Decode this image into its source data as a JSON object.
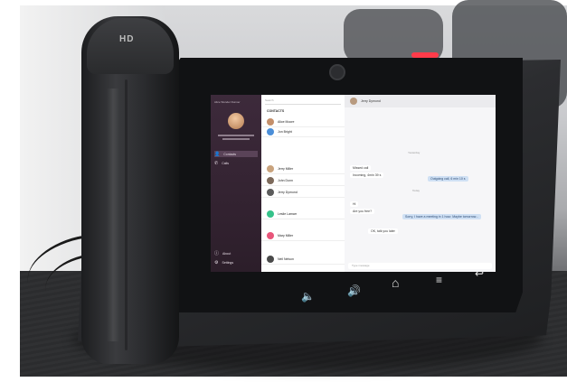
{
  "handset": {
    "brand": "HD"
  },
  "screen": {
    "owner_name": "Alice Wonder Dunner",
    "nav_items": [
      {
        "label": "Contacts",
        "icon": "person-icon",
        "active": true
      },
      {
        "label": "Calls",
        "icon": "phone-icon",
        "active": false
      }
    ],
    "nav_bottom": [
      {
        "label": "About",
        "icon": "info-icon"
      },
      {
        "label": "Settings",
        "icon": "gear-icon"
      }
    ],
    "search_placeholder": "Search",
    "contacts_title": "CONTACTS",
    "contacts": [
      {
        "letter": "",
        "name": "Alice Moore",
        "color": "#c48f6a"
      },
      {
        "letter": "",
        "name": "Jon Bright",
        "color": "#4b8ed8"
      },
      {
        "letter": "",
        "name": "Jerry Miller",
        "color": "#c9a37d"
      },
      {
        "letter": "",
        "name": "John Dunn",
        "color": "#7d6a5b"
      },
      {
        "letter": "",
        "name": "Jerry Dymond",
        "color": "#5b5b5b"
      },
      {
        "letter": "",
        "name": "Leslie Lamarr",
        "color": "#35c28a"
      },
      {
        "letter": "",
        "name": "Mary Miller",
        "color": "#e8557a"
      },
      {
        "letter": "",
        "name": "Neil Nelson",
        "color": "#4a4a4a"
      }
    ],
    "chat": {
      "title": "Jerry Dymond",
      "date_1": "Yesterday",
      "date_2": "Today",
      "messages": [
        {
          "dir": "in",
          "text": "Missed call",
          "missed": true
        },
        {
          "dir": "in",
          "text": "Incoming, 4min 39 s",
          "missed": false
        },
        {
          "dir": "out",
          "text": "Outgoing call, 6 min 10 s"
        },
        {
          "dir": "in",
          "text": "Hi"
        },
        {
          "dir": "in",
          "text": "Are you free?"
        },
        {
          "dir": "out",
          "text": "Sorry, I have a meeting in 1 hour. Maybe tomorrow..."
        },
        {
          "dir": "in",
          "text": "OK, talk you later"
        }
      ],
      "composer_placeholder": "Type message"
    }
  },
  "soft_keys": [
    {
      "name": "volume-down-icon",
      "glyph": "🔈"
    },
    {
      "name": "volume-up-icon",
      "glyph": "🔊"
    },
    {
      "name": "home-icon",
      "glyph": "⌂"
    },
    {
      "name": "menu-icon",
      "glyph": "≡"
    },
    {
      "name": "back-icon",
      "glyph": "↩"
    }
  ]
}
